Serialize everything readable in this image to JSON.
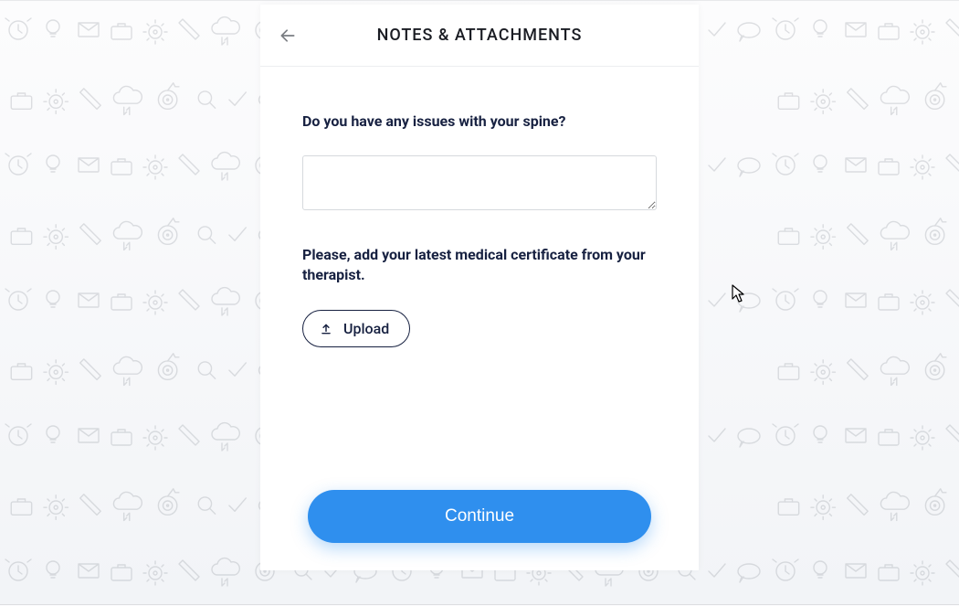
{
  "header": {
    "title": "NOTES & ATTACHMENTS"
  },
  "form": {
    "question": "Do you have any issues with your spine?",
    "textarea_value": "",
    "instruction": "Please, add your latest medical certificate from your therapist.",
    "upload_label": "Upload",
    "continue_label": "Continue"
  }
}
